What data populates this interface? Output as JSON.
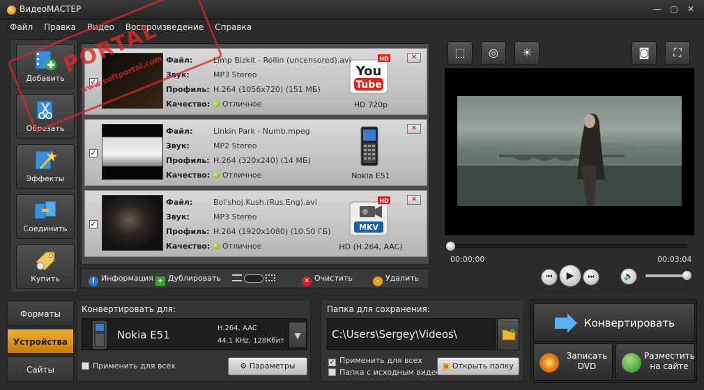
{
  "window": {
    "title": "ВидеоМАСТЕР",
    "minimize": "—",
    "maximize": "▢",
    "close": "✕"
  },
  "menu": [
    "Файл",
    "Правка",
    "Видео",
    "Воспроизведение",
    "Справка"
  ],
  "left_toolbar": [
    {
      "label": "Добавить",
      "icon": "film-add-icon"
    },
    {
      "label": "Обрезать",
      "icon": "film-cut-icon"
    },
    {
      "label": "Эффекты",
      "icon": "magic-wand-icon"
    },
    {
      "label": "Соединить",
      "icon": "film-join-icon"
    },
    {
      "label": "Купить",
      "icon": "tag-icon"
    }
  ],
  "field_labels": {
    "file": "Файл:",
    "sound": "Звук:",
    "profile": "Профиль:",
    "quality": "Качество:"
  },
  "files": [
    {
      "checked": true,
      "file": "Limp Bizkit - Rollin (uncensored).avi",
      "sound": "MP3 Stereo",
      "profile": "H.264 (1056x720) (151 МБ)",
      "quality": "Отличное",
      "device": "HD 720p",
      "device_icon": "youtube-hd-icon",
      "badge": "HD"
    },
    {
      "checked": true,
      "file": "Linkin Park - Numb.mpeg",
      "sound": "MP2 Stereo",
      "profile": "H.264 (320x240) (14 МБ)",
      "quality": "Отличное",
      "device": "Nokia E51",
      "device_icon": "phone-icon",
      "badge": ""
    },
    {
      "checked": true,
      "file": "Bol'shoj.Kush.(Rus.Eng).avi",
      "sound": "MP3 Stereo",
      "profile": "H.264 (1920x1080) (10.50 ГБ)",
      "quality": "Отличное",
      "device": "HD (H.264, AAC)",
      "device_icon": "mkv-camera-icon",
      "badge": "HD"
    }
  ],
  "list_toolbar": {
    "info": "Информация",
    "duplicate": "Дублировать",
    "clear": "Очистить",
    "delete": "Удалить"
  },
  "player": {
    "time_current": "00:00:00",
    "time_total": "00:03:04",
    "position": 0.0,
    "volume": 0.9
  },
  "bottom_tabs": [
    {
      "label": "Форматы",
      "active": false
    },
    {
      "label": "Устройства",
      "active": true
    },
    {
      "label": "Сайты",
      "active": false
    }
  ],
  "convert": {
    "title": "Конвертировать для:",
    "device": "Nokia E51",
    "spec_video": "H.264, AAC",
    "spec_audio": "44.1 KHz, 128Кбит",
    "apply_all": "Применить для всех",
    "params": "Параметры"
  },
  "save": {
    "title": "Папка для сохранения:",
    "path": "C:\\Users\\Sergey\\Videos\\",
    "apply_all": "Применить для всех",
    "source_folder": "Папка с исходным видео",
    "open_folder": "Открыть папку"
  },
  "actions": {
    "convert": "Конвертировать",
    "dvd": "Записать DVD",
    "publish": "Разместить на сайте"
  },
  "watermark": {
    "text": "PORTAL",
    "sub": "www.softportal.com"
  },
  "colors": {
    "accent": "#e8a020",
    "close_red": "#c01010",
    "quality_green": "#6fbf20"
  }
}
